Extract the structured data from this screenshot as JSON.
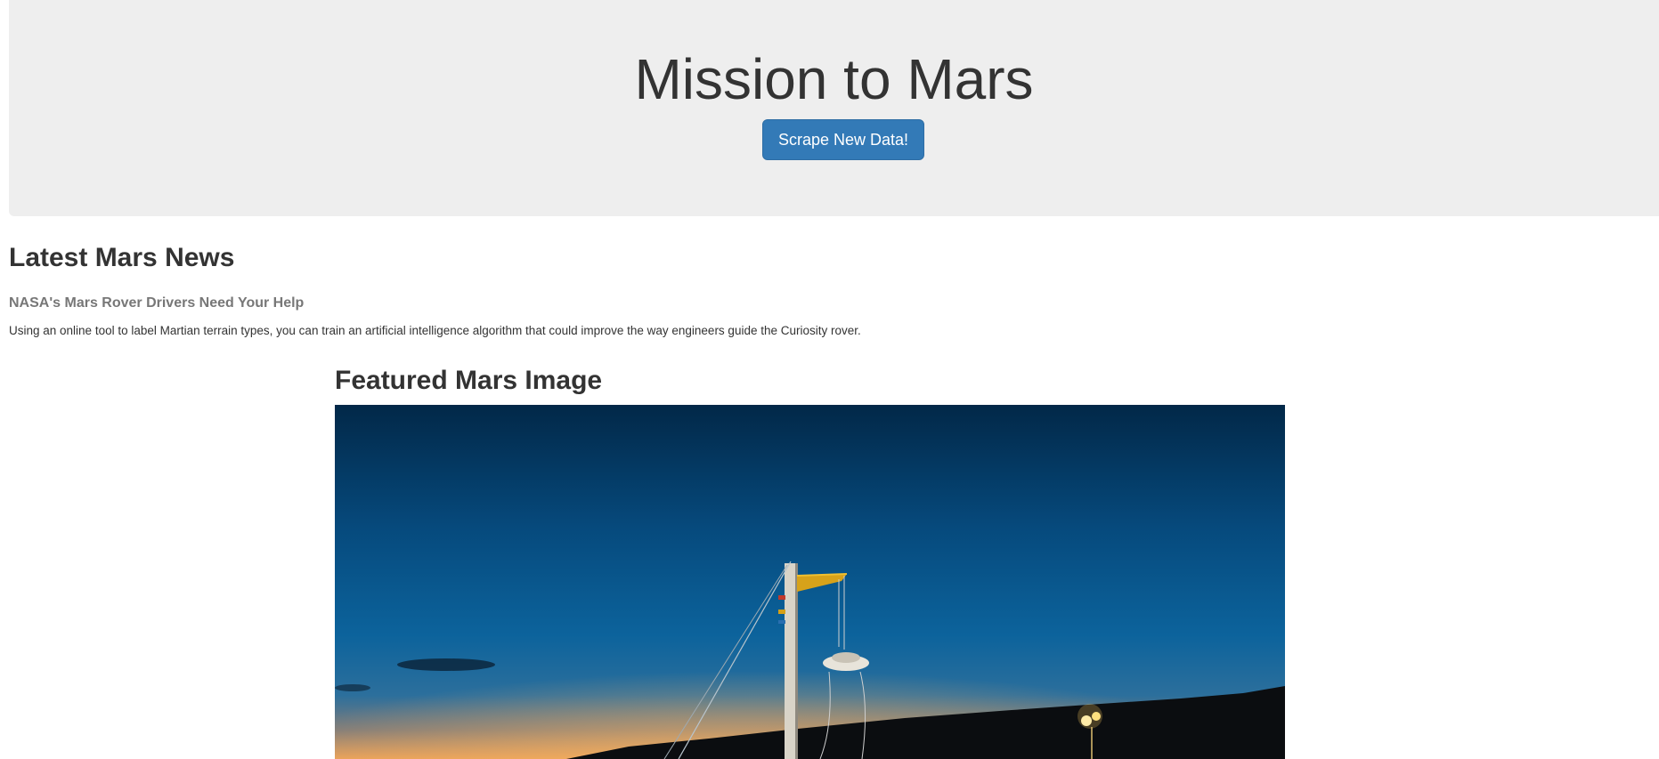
{
  "header": {
    "title": "Mission to Mars",
    "scrape_button_label": "Scrape New Data!"
  },
  "news": {
    "section_heading": "Latest Mars News",
    "title": "NASA's Mars Rover Drivers Need Your Help",
    "paragraph": "Using an online tool to label Martian terrain types, you can train an artificial intelligence algorithm that could improve the way engineers guide the Curiosity rover."
  },
  "featured": {
    "section_heading": "Featured Mars Image"
  },
  "colors": {
    "jumbotron_bg": "#eeeeee",
    "button_bg": "#337ab7",
    "text": "#333333",
    "news_title": "#777777",
    "sky_top": "#022848",
    "sky_mid": "#0a5e96",
    "horizon_glow": "#e9a15a"
  }
}
